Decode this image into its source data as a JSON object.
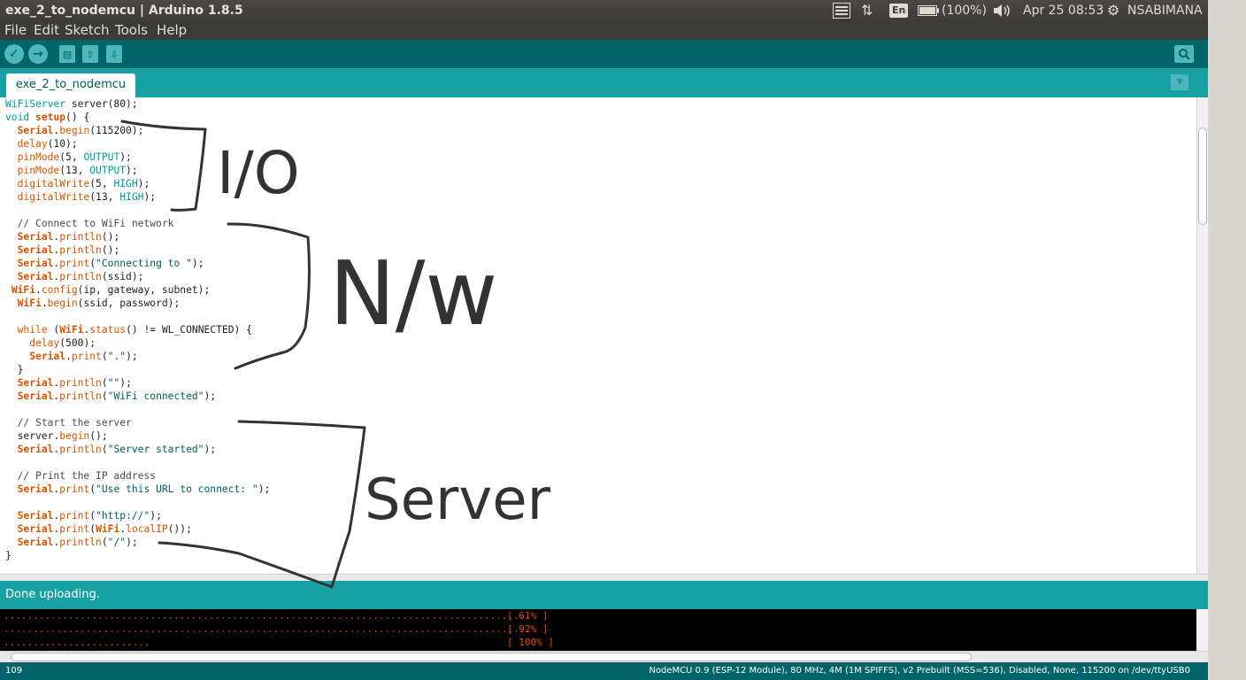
{
  "window": {
    "title": "exe_2_to_nodemcu | Arduino 1.8.5"
  },
  "system_panel": {
    "language": "En",
    "battery": "(100%)",
    "datetime": "Apr 25 08:53",
    "user": "NSABIMANA"
  },
  "menu": [
    "File",
    "Edit",
    "Sketch",
    "Tools",
    "Help"
  ],
  "toolbar": {
    "verify_icon": "check-icon",
    "upload_icon": "arrow-right-icon",
    "new_icon": "new-file-icon",
    "open_icon": "arrow-up-icon",
    "save_icon": "arrow-down-icon",
    "serial_monitor_icon": "magnifier-icon"
  },
  "tab": {
    "label": "exe_2_to_nodemcu"
  },
  "status": {
    "message": "Done uploading."
  },
  "console": [
    {
      "dots": "..........................................................................................",
      "percent": "[ 61% ]"
    },
    {
      "dots": "..........................................................................................",
      "percent": "[ 92% ]"
    },
    {
      "dots": ".........................",
      "percent": "[ 100% ]"
    }
  ],
  "bottom_bar": {
    "line_number": "109",
    "board_info": "NodeMCU 0.9 (ESP-12 Module), 80 MHz, 4M (1M SPIFFS), v2 Prebuilt (MSS=536), Disabled, None, 115200 on /dev/ttyUSB0"
  },
  "annotations": [
    "I/O",
    "N/w",
    "Server"
  ],
  "colors": {
    "toolbar": "#006468",
    "tabbar": "#17a1a5",
    "keyword": "#00979c",
    "function": "#d35400"
  }
}
